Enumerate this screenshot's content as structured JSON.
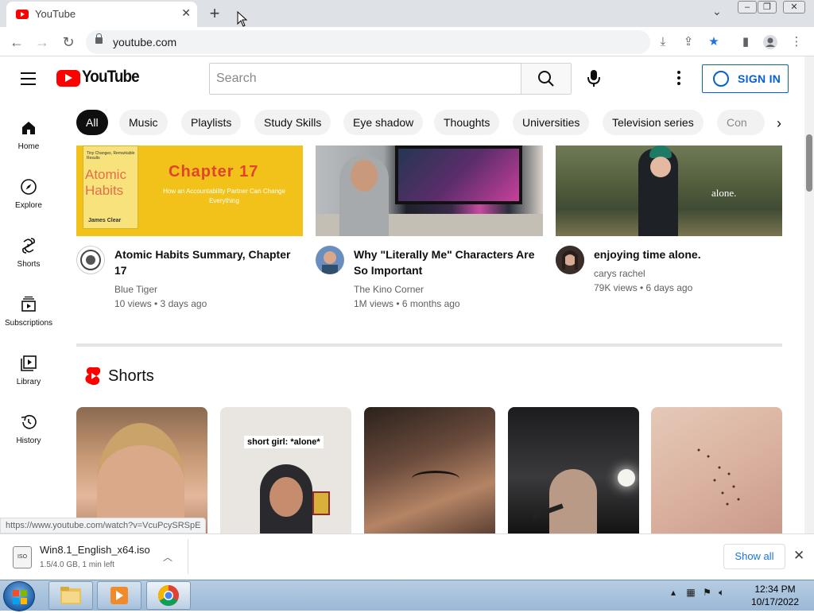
{
  "browser": {
    "tab_title": "YouTube",
    "new_tab": "+",
    "url": "youtube.com",
    "status_url": "https://www.youtube.com/watch?v=VcuPcySRSpE"
  },
  "yt": {
    "logo_text": "YouTube",
    "search_placeholder": "Search",
    "sign_in": "SIGN IN",
    "chips": [
      "All",
      "Music",
      "Playlists",
      "Study Skills",
      "Eye shadow",
      "Thoughts",
      "Universities",
      "Television series",
      "Con"
    ],
    "guide": [
      {
        "label": "Home",
        "icon": "home-icon"
      },
      {
        "label": "Explore",
        "icon": "compass-icon"
      },
      {
        "label": "Shorts",
        "icon": "shorts-icon"
      },
      {
        "label": "Subscriptions",
        "icon": "subscriptions-icon"
      },
      {
        "label": "Library",
        "icon": "library-icon"
      },
      {
        "label": "History",
        "icon": "history-icon"
      }
    ],
    "videos": [
      {
        "title": "Atomic Habits Summary, Chapter 17",
        "channel": "Blue Tiger",
        "meta": "10 views • 3 days ago",
        "thumb_text": "Chapter 17",
        "thumb_sub": "How an Accountability Partner Can Change Everything",
        "thumb_book": "Atomic Habits",
        "thumb_author": "James Clear",
        "thumb_top": "Tiny Changes, Remarkable Results"
      },
      {
        "title": "Why \"Literally Me\" Characters Are So Important",
        "channel": "The Kino Corner",
        "meta": "1M views • 6 months ago"
      },
      {
        "title": "enjoying time alone.",
        "channel": "carys rachel",
        "meta": "79K views • 6 days ago",
        "thumb_text": "alone."
      }
    ],
    "shorts_title": "Shorts",
    "shorts": [
      {
        "overlay": ""
      },
      {
        "overlay": "short girl: *alone*"
      },
      {
        "overlay": ""
      },
      {
        "overlay": ""
      },
      {
        "overlay": ""
      }
    ]
  },
  "download": {
    "filename": "Win8.1_English_x64.iso",
    "progress_text": "1.5/4.0 GB, 1 min left",
    "icon_text": "ISO",
    "show_all": "Show all"
  },
  "taskbar": {
    "time": "12:34 PM",
    "date": "10/17/2022"
  },
  "colors": {
    "brand_red": "#ff0000",
    "link_blue": "#065fd4"
  }
}
